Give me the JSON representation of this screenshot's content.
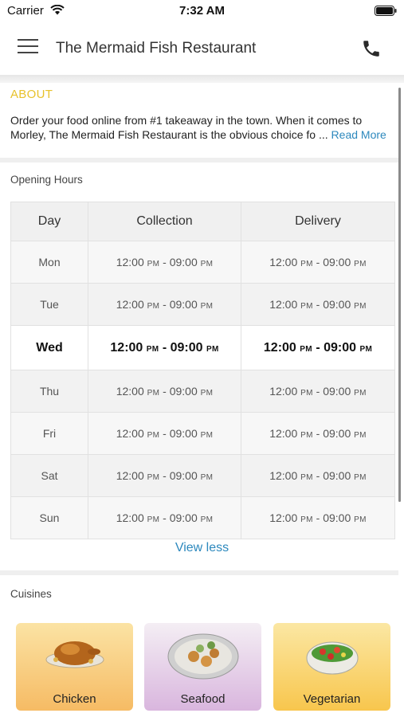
{
  "status_bar": {
    "carrier": "Carrier",
    "time": "7:32 AM"
  },
  "header": {
    "title": "The Mermaid Fish Restaurant",
    "menu_icon": "hamburger-menu-icon",
    "phone_icon": "phone-icon"
  },
  "about": {
    "title": "ABOUT",
    "text": "Order your food online from #1 takeaway in the town. When it comes to Morley, The Mermaid Fish Restaurant is the obvious choice fo ...",
    "read_more": "Read More"
  },
  "opening_hours": {
    "title": "Opening Hours",
    "columns": [
      "Day",
      "Collection",
      "Delivery"
    ],
    "rows": [
      {
        "day": "Mon",
        "collection": {
          "start": "12:00",
          "start_ampm": "PM",
          "end": "09:00",
          "end_ampm": "PM"
        },
        "delivery": {
          "start": "12:00",
          "start_ampm": "PM",
          "end": "09:00",
          "end_ampm": "PM"
        }
      },
      {
        "day": "Tue",
        "collection": {
          "start": "12:00",
          "start_ampm": "PM",
          "end": "09:00",
          "end_ampm": "PM"
        },
        "delivery": {
          "start": "12:00",
          "start_ampm": "PM",
          "end": "09:00",
          "end_ampm": "PM"
        }
      },
      {
        "day": "Wed",
        "collection": {
          "start": "12:00",
          "start_ampm": "PM",
          "end": "09:00",
          "end_ampm": "PM"
        },
        "delivery": {
          "start": "12:00",
          "start_ampm": "PM",
          "end": "09:00",
          "end_ampm": "PM"
        }
      },
      {
        "day": "Thu",
        "collection": {
          "start": "12:00",
          "start_ampm": "PM",
          "end": "09:00",
          "end_ampm": "PM"
        },
        "delivery": {
          "start": "12:00",
          "start_ampm": "PM",
          "end": "09:00",
          "end_ampm": "PM"
        }
      },
      {
        "day": "Fri",
        "collection": {
          "start": "12:00",
          "start_ampm": "PM",
          "end": "09:00",
          "end_ampm": "PM"
        },
        "delivery": {
          "start": "12:00",
          "start_ampm": "PM",
          "end": "09:00",
          "end_ampm": "PM"
        }
      },
      {
        "day": "Sat",
        "collection": {
          "start": "12:00",
          "start_ampm": "PM",
          "end": "09:00",
          "end_ampm": "PM"
        },
        "delivery": {
          "start": "12:00",
          "start_ampm": "PM",
          "end": "09:00",
          "end_ampm": "PM"
        }
      },
      {
        "day": "Sun",
        "collection": {
          "start": "12:00",
          "start_ampm": "PM",
          "end": "09:00",
          "end_ampm": "PM"
        },
        "delivery": {
          "start": "12:00",
          "start_ampm": "PM",
          "end": "09:00",
          "end_ampm": "PM"
        }
      }
    ],
    "highlighted_day": "Wed",
    "toggle_label": "View less"
  },
  "cuisines": {
    "title": "Cuisines",
    "items": [
      {
        "label": "Chicken",
        "image": "roast-chicken-icon",
        "color_top": "#fbe3a4",
        "color_bottom": "#f6bb64"
      },
      {
        "label": "Seafood",
        "image": "seafood-platter-icon",
        "color_top": "#f4eef4",
        "color_bottom": "#d9b6de"
      },
      {
        "label": "Vegetarian",
        "image": "salad-bowl-icon",
        "color_top": "#fbe7a3",
        "color_bottom": "#f8c64d"
      }
    ]
  },
  "colors": {
    "accent_link": "#2c88bd",
    "about_title": "#e8c22c"
  }
}
